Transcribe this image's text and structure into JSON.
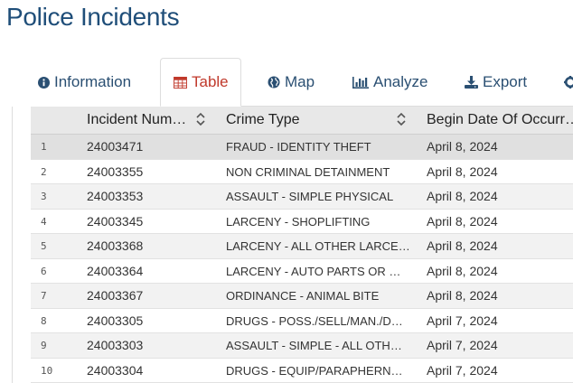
{
  "page": {
    "title": "Police Incidents"
  },
  "tabs": [
    {
      "label": "Information",
      "icon": "info-circle-icon"
    },
    {
      "label": "Table",
      "icon": "table-icon"
    },
    {
      "label": "Map",
      "icon": "globe-icon"
    },
    {
      "label": "Analyze",
      "icon": "bar-chart-icon"
    },
    {
      "label": "Export",
      "icon": "download-icon"
    }
  ],
  "colors": {
    "title": "#1f4e79",
    "tab_link": "#2a4f72",
    "tab_active": "#c0392b",
    "header_bg": "#e8e8e8"
  },
  "table": {
    "columns": [
      "Incident Num…",
      "Crime Type",
      "Begin Date Of Occurr…"
    ],
    "rows": [
      {
        "n": "1",
        "incident": "24003471",
        "crime": "FRAUD - IDENTITY THEFT",
        "date": "April 8, 2024"
      },
      {
        "n": "2",
        "incident": "24003355",
        "crime": "NON CRIMINAL DETAINMENT",
        "date": "April 8, 2024"
      },
      {
        "n": "3",
        "incident": "24003353",
        "crime": "ASSAULT - SIMPLE PHYSICAL",
        "date": "April 8, 2024"
      },
      {
        "n": "4",
        "incident": "24003345",
        "crime": "LARCENY - SHOPLIFTING",
        "date": "April 8, 2024"
      },
      {
        "n": "5",
        "incident": "24003368",
        "crime": "LARCENY - ALL OTHER LARCE…",
        "date": "April 8, 2024"
      },
      {
        "n": "6",
        "incident": "24003364",
        "crime": "LARCENY - AUTO PARTS OR …",
        "date": "April 8, 2024"
      },
      {
        "n": "7",
        "incident": "24003367",
        "crime": "ORDINANCE - ANIMAL BITE",
        "date": "April 8, 2024"
      },
      {
        "n": "8",
        "incident": "24003305",
        "crime": "DRUGS - POSS./SELL/MAN./D…",
        "date": "April 7, 2024"
      },
      {
        "n": "9",
        "incident": "24003303",
        "crime": "ASSAULT - SIMPLE - ALL OTH…",
        "date": "April 7, 2024"
      },
      {
        "n": "10",
        "incident": "24003304",
        "crime": "DRUGS - EQUIP/PARAPHERN…",
        "date": "April 7, 2024"
      }
    ]
  }
}
